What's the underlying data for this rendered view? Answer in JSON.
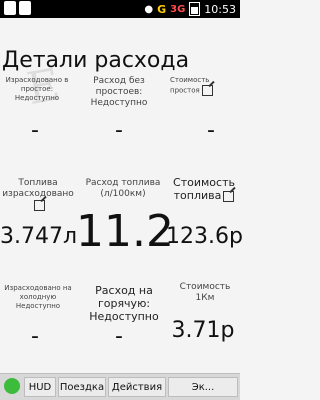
{
  "status_bar": {
    "network": "G",
    "network2": "3G",
    "time": "10:53"
  },
  "page": {
    "title": "Детали расхода"
  },
  "grid": {
    "row1": {
      "c1_label": "Израсходовано в простое: Недоступно",
      "c1_value": "-",
      "c2_label": "Расход без простоев: Недоступно",
      "c2_value": "-",
      "c3_label": "Стоимость простоя",
      "c3_value": "-"
    },
    "row2": {
      "c1_label": "Топлива израсходовано",
      "c1_value": "3.747л",
      "c2_label": "Расход топлива (л/100км)",
      "c2_value": "11.2",
      "c3_label": "Стоимость топлива",
      "c3_value": "123.6р"
    },
    "row3": {
      "c1_label": "Израсходовано на холодную Недоступно",
      "c1_value": "-",
      "c2_label": "Расход на горячую: Недоступно",
      "c2_value": "-",
      "c3_label": "Стоимость 1Км",
      "c3_value": "3.71р"
    }
  },
  "bottom_bar": {
    "hud": "HUD",
    "trip": "Поездка",
    "actions": "Действия",
    "more": "Эк..."
  }
}
